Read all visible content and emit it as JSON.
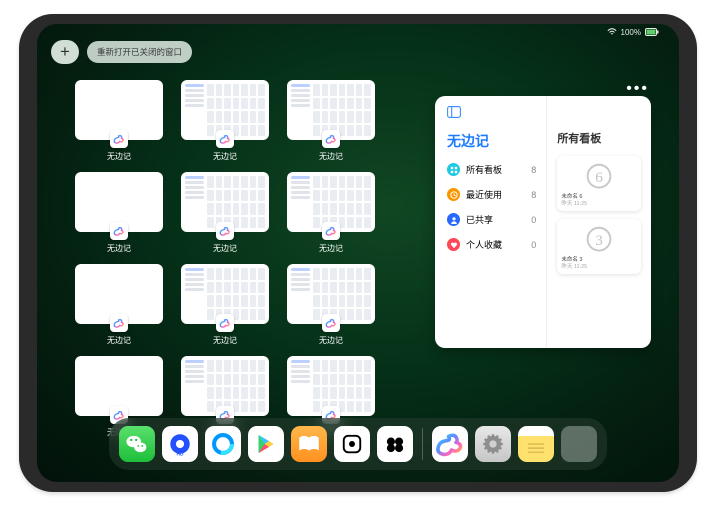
{
  "status": {
    "wifi": "wifi-icon",
    "battery_pct": "100%",
    "battery_icon": "battery-icon"
  },
  "top_controls": {
    "add_label": "+",
    "reopen_label": "重新打开已关闭的窗口"
  },
  "app_switcher": {
    "app_name": "无边记",
    "thumbs": [
      {
        "variant": "blank"
      },
      {
        "variant": "content"
      },
      {
        "variant": "content"
      },
      {
        "variant": "blank"
      },
      {
        "variant": "content"
      },
      {
        "variant": "content"
      },
      {
        "variant": "blank"
      },
      {
        "variant": "content"
      },
      {
        "variant": "content"
      },
      {
        "variant": "blank"
      },
      {
        "variant": "content"
      },
      {
        "variant": "content"
      }
    ]
  },
  "side_panel": {
    "left": {
      "title": "无边记",
      "rows": [
        {
          "badge_color": "cyan",
          "icon": "grid-icon",
          "label": "所有看板",
          "count": "8"
        },
        {
          "badge_color": "orange",
          "icon": "clock-icon",
          "label": "最近使用",
          "count": "8"
        },
        {
          "badge_color": "blue",
          "icon": "person-icon",
          "label": "已共享",
          "count": "0"
        },
        {
          "badge_color": "red",
          "icon": "heart-icon",
          "label": "个人收藏",
          "count": "0"
        }
      ]
    },
    "right": {
      "title": "所有看板",
      "boards": [
        {
          "sketch": "6",
          "name": "未命名 6",
          "time": "昨天 11:25"
        },
        {
          "sketch": "3",
          "name": "未命名 3",
          "time": "昨天 11:25"
        }
      ]
    }
  },
  "dock": {
    "apps": [
      {
        "id": "wechat",
        "name": "wechat-icon",
        "class": "d-wechat"
      },
      {
        "id": "browser",
        "name": "browser-icon",
        "class": "d-browser"
      },
      {
        "id": "qbrowser",
        "name": "q-browser-icon",
        "class": "d-q"
      },
      {
        "id": "play",
        "name": "play-store-icon",
        "class": "d-play"
      },
      {
        "id": "books",
        "name": "books-icon",
        "class": "d-books"
      },
      {
        "id": "dice",
        "name": "dice-icon",
        "class": "d-dice"
      },
      {
        "id": "control",
        "name": "controller-icon",
        "class": "d-control"
      }
    ],
    "recent_apps": [
      {
        "id": "freeform",
        "name": "freeform-icon",
        "class": "d-freeform"
      },
      {
        "id": "settings",
        "name": "settings-icon",
        "class": "d-settings"
      },
      {
        "id": "notes",
        "name": "notes-icon",
        "class": "d-notes"
      },
      {
        "id": "recents",
        "name": "recent-apps-icon",
        "class": "d-recent"
      }
    ]
  }
}
